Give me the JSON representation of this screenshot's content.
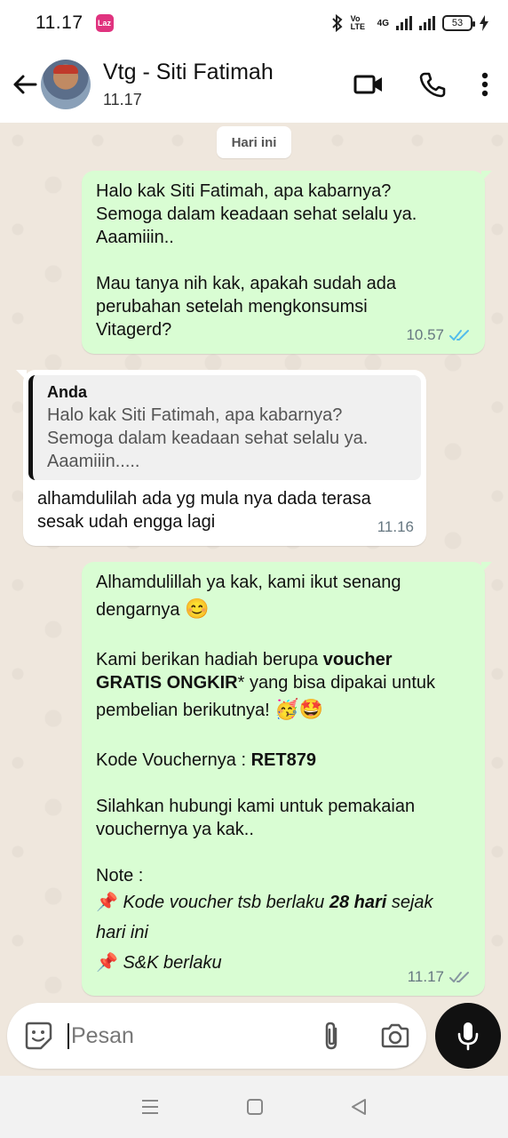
{
  "status_bar": {
    "time": "11.17",
    "app_badge": "lazada",
    "network": "4G",
    "volte": "Vo LTE",
    "battery": "53"
  },
  "header": {
    "contact_name": "Vtg - Siti Fatimah",
    "contact_status": "11.17"
  },
  "chat": {
    "date_label": "Hari ini",
    "messages": [
      {
        "direction": "out",
        "lines": [
          "Halo kak Siti Fatimah, apa kabarnya?",
          "Semoga dalam keadaan sehat selalu ya.",
          "Aaamiiin..",
          "Mau tanya nih kak, apakah sudah ada",
          "perubahan setelah mengkonsumsi",
          "Vitagerd?"
        ],
        "time": "10.57",
        "ticks": "read"
      },
      {
        "direction": "in",
        "quote_author": "Anda",
        "quote_lines": [
          "Halo kak Siti Fatimah, apa kabarnya?",
          "Semoga dalam keadaan sehat selalu ya.",
          "Aaamiiin....."
        ],
        "lines": [
          "alhamdulilah ada yg mula nya dada terasa",
          "sesak udah engga lagi"
        ],
        "time": "11.16"
      },
      {
        "direction": "out",
        "line1": "Alhamdulillah ya kak, kami ikut senang",
        "line2": "dengarnya",
        "line2_emoji": "😊",
        "line3a": "Kami berikan hadiah berupa ",
        "line3b": "voucher",
        "line4a": "GRATIS ONGKIR",
        "line4b": "* yang bisa dipakai untuk",
        "line5": "pembelian berikutnya! ",
        "line5_emoji": "🥳🤩",
        "code_label": "Kode Vouchernya : ",
        "code_value": "RET879",
        "line7": "Silahkan hubungi kami untuk pemakaian",
        "line8": "vouchernya ya kak..",
        "note_label": "Note :",
        "note1a": " Kode voucher tsb berlaku ",
        "note1b": "28 hari",
        "note1c": " sejak",
        "note1d": "hari ini",
        "note2": " S&K berlaku",
        "pin_glyph": "📌",
        "time": "11.17",
        "ticks": "delivered"
      }
    ]
  },
  "input": {
    "placeholder": "Pesan"
  },
  "colors": {
    "outgoing_bubble": "#d9fdd3",
    "incoming_bubble": "#ffffff",
    "read_tick": "#53bdeb",
    "background": "#efe7dd"
  }
}
